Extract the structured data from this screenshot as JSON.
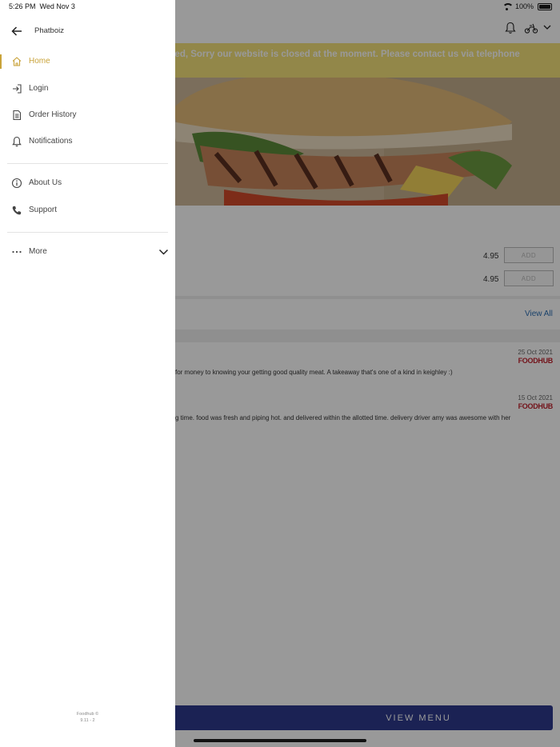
{
  "status_bar": {
    "time": "5:26 PM",
    "date": "Wed Nov 3",
    "battery": "100%"
  },
  "drawer": {
    "store_name": "Phatboiz",
    "items": [
      {
        "label": "Home",
        "icon": "home-icon",
        "active": true
      },
      {
        "label": "Login",
        "icon": "login-icon"
      },
      {
        "label": "Order History",
        "icon": "order-history-icon"
      },
      {
        "label": "Notifications",
        "icon": "bell-icon"
      },
      {
        "label": "About Us",
        "icon": "info-icon"
      },
      {
        "label": "Support",
        "icon": "phone-icon"
      },
      {
        "label": "More",
        "icon": "more-dots-icon"
      }
    ],
    "footer_line1": "Foodhub ©",
    "footer_line2": "9.11 - 2"
  },
  "background": {
    "banner_line1": "osed, Sorry our website is closed at the moment. Please contact us via telephone",
    "banner_line2": ".",
    "menu": [
      {
        "price": "4.95",
        "button": "ADD"
      },
      {
        "price": "4.95",
        "button": "ADD"
      }
    ],
    "view_all": "View All",
    "reviews": [
      {
        "date": "25 Oct 2021",
        "brand": "FOODHUB",
        "text": "for money to knowing your getting good quality meat. A takeaway that's one of a kind in keighley :)"
      },
      {
        "date": "15 Oct 2021",
        "brand": "FOODHUB",
        "text": "g time. food was fresh and piping hot. and delivered within the allotted time. delivery driver amy was awesome with her"
      }
    ],
    "view_menu": "VIEW MENU"
  },
  "colors": {
    "accent": "#c9a33a",
    "banner": "#f3e27a",
    "primary_button": "#2e3a8c",
    "link": "#2d6fb3",
    "brand_red": "#c0222e"
  }
}
